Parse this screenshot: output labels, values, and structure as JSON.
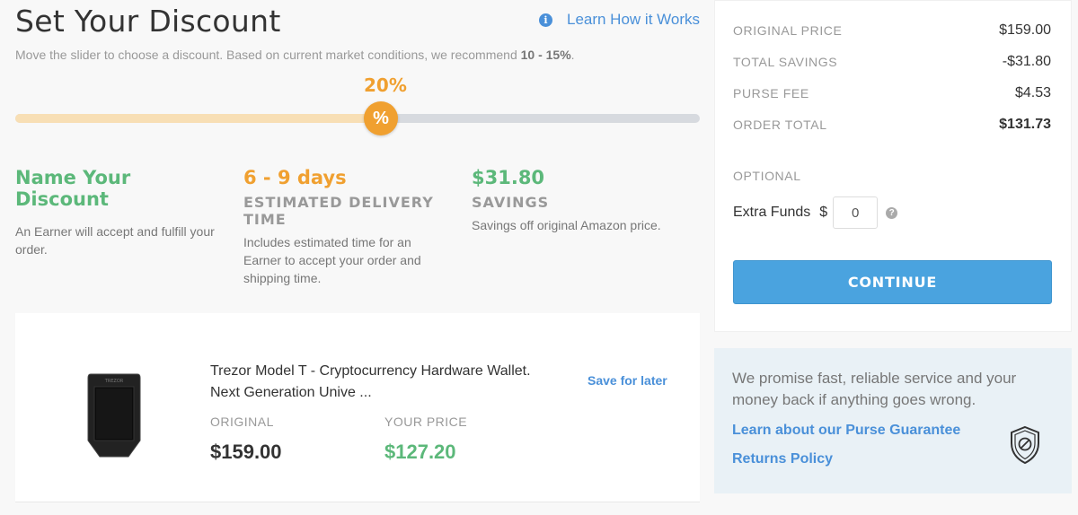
{
  "header": {
    "title": "Set Your Discount",
    "learn_link": "Learn How it Works",
    "subtitle_prefix": "Move the slider to choose a discount. Based on current market conditions, we recommend ",
    "subtitle_bold": "10 - 15%",
    "subtitle_suffix": "."
  },
  "slider": {
    "percent_label": "20%",
    "thumb_symbol": "%",
    "value_percent": 20
  },
  "info": {
    "discount": {
      "head": "Name Your Discount",
      "desc": "An Earner will accept and fulfill your order."
    },
    "delivery": {
      "head": "6 - 9 days",
      "sub": "ESTIMATED DELIVERY TIME",
      "desc": "Includes estimated time for an Earner to accept your order and shipping time."
    },
    "savings": {
      "head": "$31.80",
      "sub": "SAVINGS",
      "desc": "Savings off original Amazon price."
    }
  },
  "product": {
    "title": "Trezor Model T - Cryptocurrency Hardware Wallet. Next Generation Unive ...",
    "save_for_later": "Save for later",
    "original_label": "ORIGINAL",
    "original_price": "$159.00",
    "your_price_label": "YOUR PRICE",
    "your_price": "$127.20",
    "device_brand": "TREZOR"
  },
  "summary": {
    "original_price_label": "ORIGINAL PRICE",
    "original_price": "$159.00",
    "total_savings_label": "TOTAL SAVINGS",
    "total_savings": "-$31.80",
    "purse_fee_label": "PURSE FEE",
    "purse_fee": "$4.53",
    "order_total_label": "ORDER TOTAL",
    "order_total": "$131.73",
    "optional_label": "OPTIONAL",
    "extra_funds_label": "Extra Funds",
    "currency": "$",
    "extra_funds_value": "0",
    "help_symbol": "?",
    "continue_label": "CONTINUE"
  },
  "guarantee": {
    "text": "We promise fast, reliable service and your money back if anything goes wrong.",
    "guarantee_link": "Learn about our Purse Guarantee",
    "returns_link": "Returns Policy"
  },
  "colors": {
    "accent_blue": "#4a90d9",
    "button_blue": "#4aa3df",
    "green": "#5cb87a",
    "orange": "#f0a030"
  },
  "icons": {
    "info": "info-icon",
    "help": "help-icon",
    "shield": "shield-icon",
    "percent": "percent-icon"
  }
}
